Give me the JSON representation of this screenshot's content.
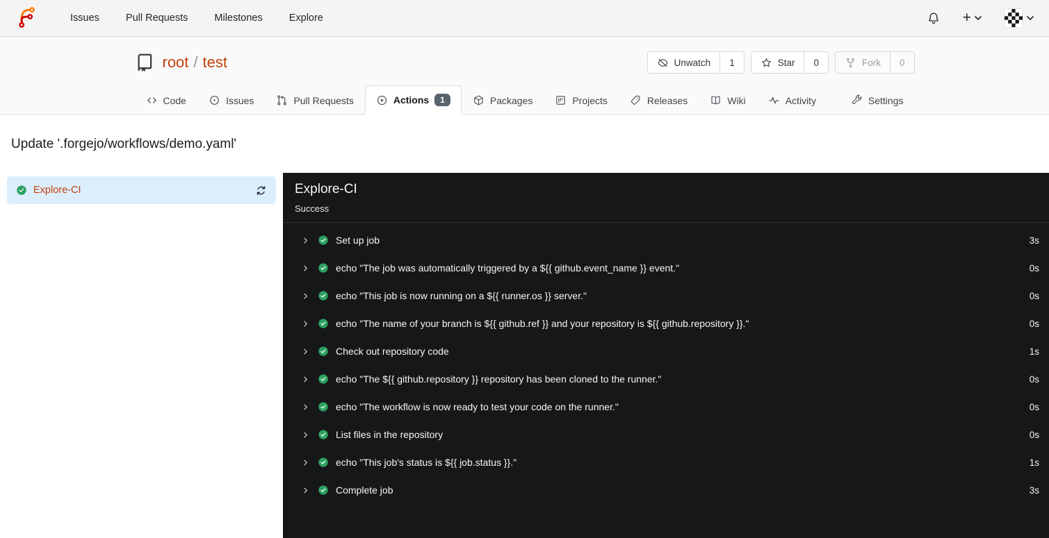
{
  "colors": {
    "accent": "#c2410c",
    "success_green": "#2da160",
    "panel_bg": "#161719",
    "badge_gray": "#59636e",
    "selected_job_bg": "#dceefc"
  },
  "icons": {
    "plus": "+"
  },
  "navbar": {
    "links": [
      {
        "label": "Issues"
      },
      {
        "label": "Pull Requests"
      },
      {
        "label": "Milestones"
      },
      {
        "label": "Explore"
      }
    ]
  },
  "repo": {
    "owner": "root",
    "separator": "/",
    "name": "test",
    "buttons": {
      "unwatch_label": "Unwatch",
      "unwatch_count": "1",
      "star_label": "Star",
      "star_count": "0",
      "fork_label": "Fork",
      "fork_count": "0"
    },
    "tabs": [
      {
        "label": "Code"
      },
      {
        "label": "Issues"
      },
      {
        "label": "Pull Requests"
      },
      {
        "label": "Actions",
        "badge": "1"
      },
      {
        "label": "Packages"
      },
      {
        "label": "Projects"
      },
      {
        "label": "Releases"
      },
      {
        "label": "Wiki"
      },
      {
        "label": "Activity"
      },
      {
        "label": "Settings"
      }
    ]
  },
  "page": {
    "title": "Update '.forgejo/workflows/demo.yaml'"
  },
  "sidebar": {
    "job_name": "Explore-CI"
  },
  "panel": {
    "title": "Explore-CI",
    "status": "Success",
    "steps": [
      {
        "label": "Set up job",
        "duration": "3s"
      },
      {
        "label": "echo \"The job was automatically triggered by a ${{ github.event_name }} event.\"",
        "duration": "0s"
      },
      {
        "label": "echo \"This job is now running on a ${{ runner.os }} server.\"",
        "duration": "0s"
      },
      {
        "label": "echo \"The name of your branch is ${{ github.ref }} and your repository is ${{ github.repository }}.\"",
        "duration": "0s"
      },
      {
        "label": "Check out repository code",
        "duration": "1s"
      },
      {
        "label": "echo \"The ${{ github.repository }} repository has been cloned to the runner.\"",
        "duration": "0s"
      },
      {
        "label": "echo \"The workflow is now ready to test your code on the runner.\"",
        "duration": "0s"
      },
      {
        "label": "List files in the repository",
        "duration": "0s"
      },
      {
        "label": "echo \"This job's status is ${{ job.status }}.\"",
        "duration": "1s"
      },
      {
        "label": "Complete job",
        "duration": "3s"
      }
    ]
  }
}
